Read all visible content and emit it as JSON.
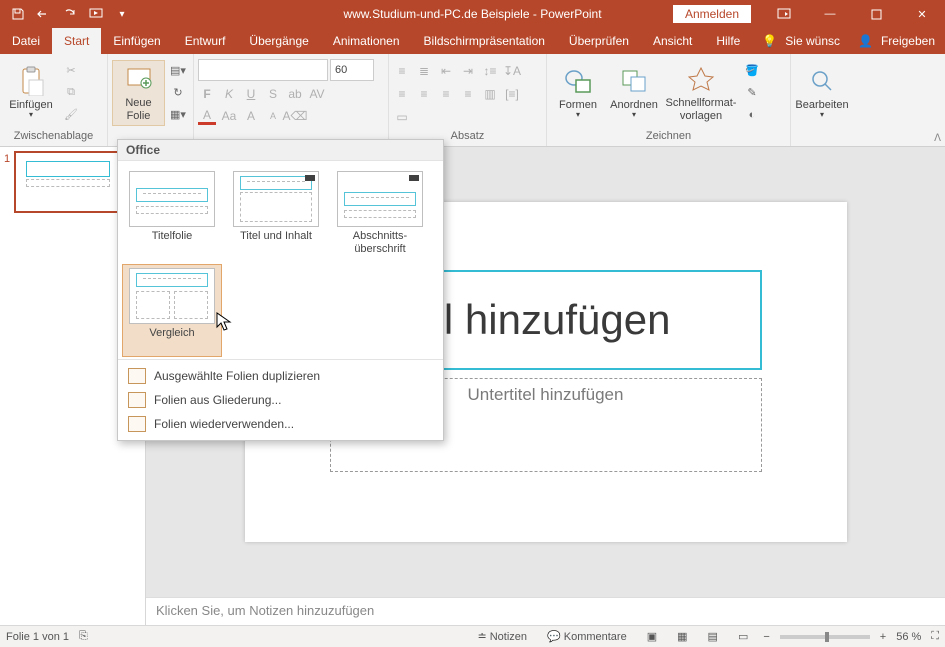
{
  "title": "www.Studium-und-PC.de  Beispiele  -  PowerPoint",
  "signin": "Anmelden",
  "tabs": {
    "datei": "Datei",
    "start": "Start",
    "einfuegen": "Einfügen",
    "entwurf": "Entwurf",
    "uebergaenge": "Übergänge",
    "animationen": "Animationen",
    "bildschirm": "Bildschirmpräsentation",
    "ueberpruefen": "Überprüfen",
    "ansicht": "Ansicht",
    "hilfe": "Hilfe",
    "siewunsch": "Sie wünsc",
    "freigeben": "Freigeben"
  },
  "ribbon": {
    "clipboard": {
      "paste": "Einfügen",
      "group": "Zwischenablage"
    },
    "slides": {
      "newslide": "Neue\nFolie"
    },
    "font": {
      "size": "60",
      "bold": "F",
      "italic": "K",
      "underline": "U",
      "strike": "S"
    },
    "paragraph": {
      "group": "Absatz"
    },
    "drawing": {
      "shapes": "Formen",
      "arrange": "Anordnen",
      "quick": "Schnellformat-\nvorlagen",
      "group": "Zeichnen"
    },
    "edit": {
      "label": "Bearbeiten"
    }
  },
  "gallery": {
    "head": "Office",
    "layouts": [
      {
        "label": "Titelfolie"
      },
      {
        "label": "Titel und Inhalt"
      },
      {
        "label": "Abschnitts-\nüberschrift"
      },
      {
        "label": "Vergleich"
      }
    ],
    "menu": {
      "dup": "Ausgewählte Folien duplizieren",
      "outline": "Folien aus Gliederung...",
      "reuse": "Folien wiederverwenden..."
    }
  },
  "slide": {
    "title_placeholder": "el hinzufügen",
    "subtitle_placeholder": "Untertitel hinzufügen"
  },
  "notes_placeholder": "Klicken Sie, um Notizen hinzuzufügen",
  "thumb": {
    "num": "1"
  },
  "status": {
    "slide": "Folie 1 von 1",
    "notes": "Notizen",
    "comments": "Kommentare",
    "zoom": "56 %"
  }
}
